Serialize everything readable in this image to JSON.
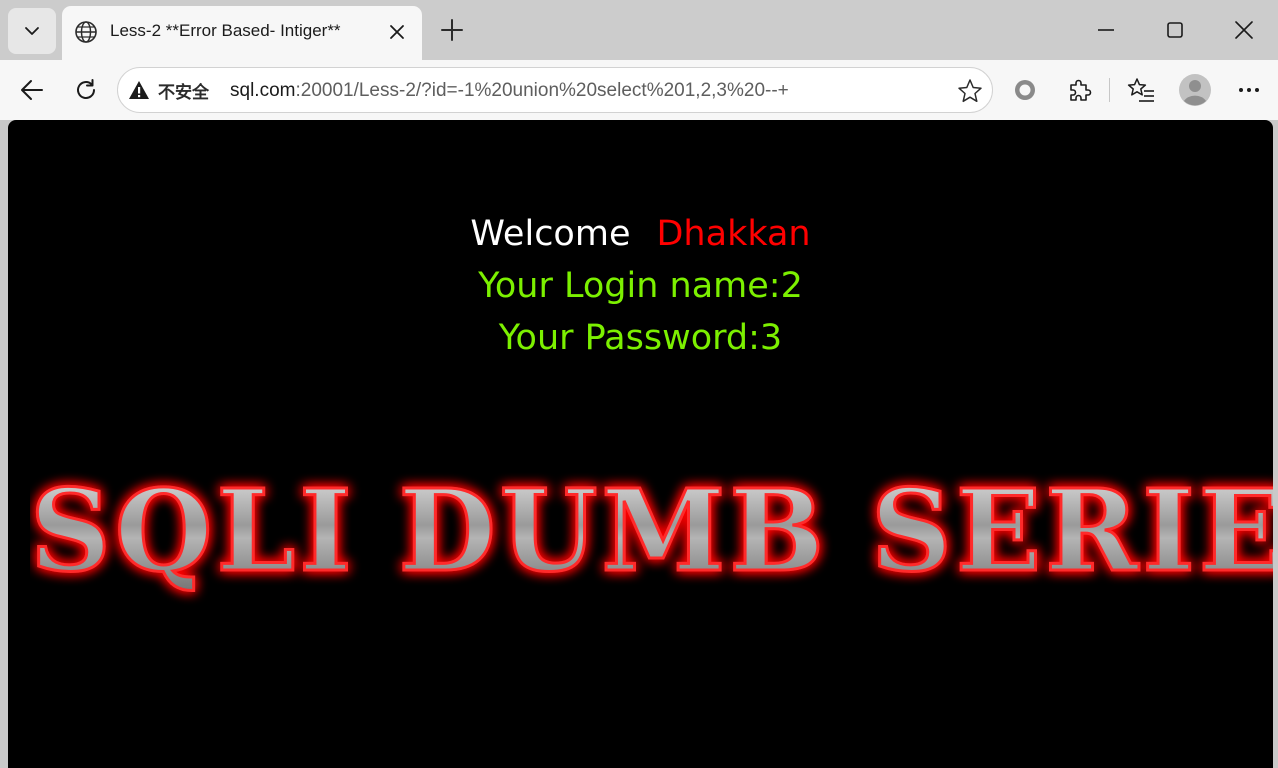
{
  "browser": {
    "tab": {
      "title": "Less-2 **Error Based- Intiger**"
    },
    "address": {
      "security_label": "不安全",
      "url_host": "sql.com",
      "url_rest": ":20001/Less-2/?id=-1%20union%20select%201,2,3%20--+"
    },
    "icons": {
      "tab_list": "chevron-down-icon",
      "favicon": "globe-icon",
      "tab_close": "close-icon",
      "new_tab": "plus-icon",
      "minimize": "minimize-icon",
      "maximize": "maximize-icon",
      "close_window": "close-icon",
      "back": "back-arrow-icon",
      "reload": "reload-icon",
      "security": "warning-icon",
      "favorite": "star-icon",
      "browser_essentials": "circle-icon",
      "extensions": "puzzle-icon",
      "favorites": "favorites-list-icon",
      "profile": "avatar-icon",
      "menu": "more-icon"
    }
  },
  "page": {
    "welcome_label": "Welcome",
    "welcome_name": "Dhakkan",
    "login_line": "Your Login name:2",
    "password_line": "Your Password:3",
    "banner_text": "SQLI DUMB SERIES"
  },
  "colors": {
    "background": "#000000",
    "welcome": "#ffffff",
    "name": "#ff0000",
    "credentials": "#7cf000",
    "banner_glow": "#ff0000"
  }
}
